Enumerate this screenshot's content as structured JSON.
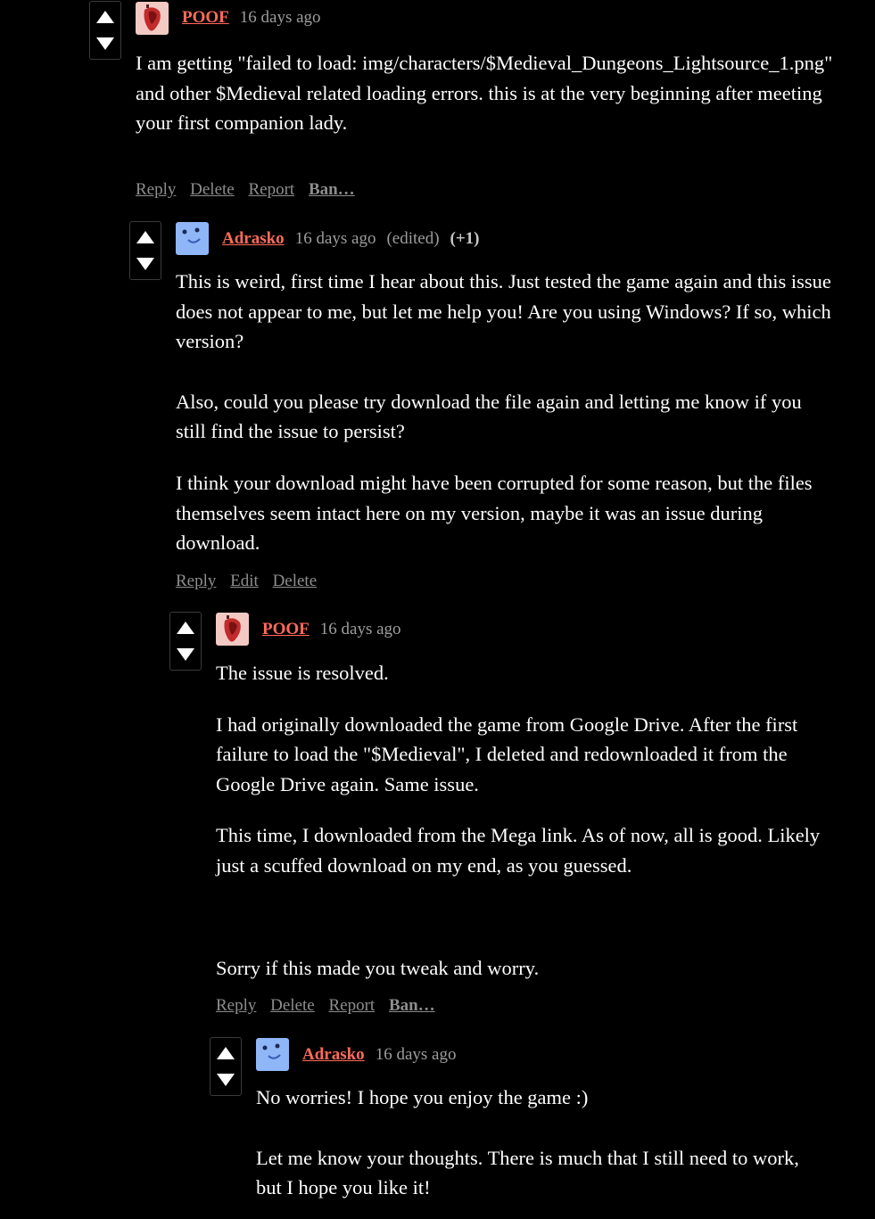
{
  "colors": {
    "background": "#000000",
    "username": "#ff6b5b",
    "meta": "#9c9c9c",
    "action": "#8d8d8d",
    "text": "#ffffff"
  },
  "comments": [
    {
      "username": "POOF",
      "avatar": "poof-avatar",
      "time": "16 days ago",
      "body": [
        "I am getting \"failed to load: img/characters/$Medieval_Dungeons_Lightsource_1.png\" and other $Medieval related loading errors. this is at the very beginning after meeting your first companion lady."
      ],
      "actions": {
        "reply": "Reply",
        "delete": "Delete",
        "report": "Report",
        "ban": "Ban…"
      }
    },
    {
      "username": "Adrasko",
      "avatar": "adrasko-avatar",
      "time": "16 days ago",
      "edited": "(edited)",
      "score": "(+1)",
      "body": [
        "This is weird, first time I hear about this. Just tested the game again and this issue does not appear to me, but let me help you! Are you using Windows? If so, which version?",
        "Also, could you please try download the file again and letting me know if you still find the issue to persist?",
        "I think your download might have been corrupted for some reason, but the files themselves seem intact here on my version, maybe it was an issue during download."
      ],
      "actions": {
        "reply": "Reply",
        "edit": "Edit",
        "delete": "Delete"
      }
    },
    {
      "username": "POOF",
      "avatar": "poof-avatar",
      "time": "16 days ago",
      "body": [
        "The issue is resolved.",
        "I had originally downloaded the game from Google Drive. After the first failure to load the \"$Medieval\", I deleted and redownloaded it from the Google Drive again. Same issue.",
        "This time, I downloaded from the Mega link. As of now, all is good. Likely just a scuffed download on my end, as you guessed.",
        "Sorry if this made you tweak and worry."
      ],
      "actions": {
        "reply": "Reply",
        "delete": "Delete",
        "report": "Report",
        "ban": "Ban…"
      }
    },
    {
      "username": "Adrasko",
      "avatar": "adrasko-avatar",
      "time": "16 days ago",
      "body": [
        "No worries! I hope you enjoy the game :)",
        "Let me know your thoughts. There is much that I still need to work, but I hope you like it!"
      ]
    }
  ]
}
